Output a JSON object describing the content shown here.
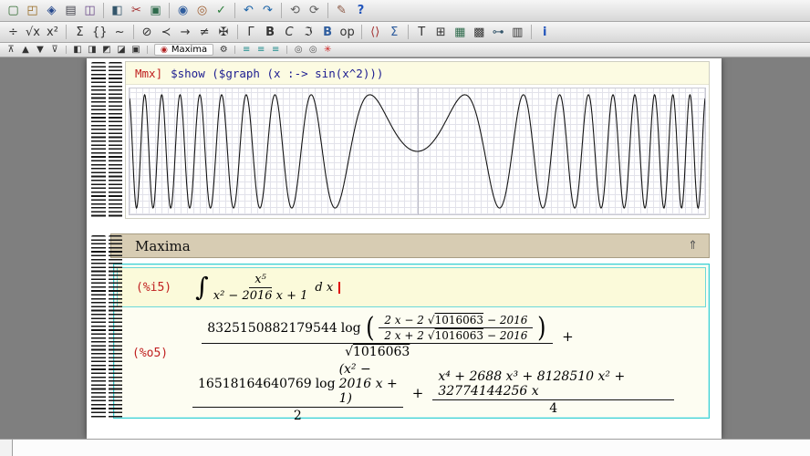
{
  "symbols": {
    "integral": "∫",
    "radical": "√",
    "plus": "+",
    "lparen": "(",
    "rparen": ")"
  },
  "toolbars": {
    "main": {
      "icons": [
        {
          "name": "new-document-icon",
          "glyph": "▢",
          "color": "#2f6b2f"
        },
        {
          "name": "open-document-icon",
          "glyph": "◰",
          "color": "#96691f"
        },
        {
          "name": "save-document-icon",
          "glyph": "◈",
          "color": "#24478c"
        },
        {
          "name": "print-icon",
          "glyph": "▤",
          "color": "#45454f"
        },
        {
          "name": "preview-icon",
          "glyph": "◫",
          "color": "#6b4a8a"
        },
        {
          "sep": true
        },
        {
          "name": "copy-icon",
          "glyph": "◧",
          "color": "#34566b"
        },
        {
          "name": "cut-icon",
          "glyph": "✂",
          "color": "#a33131"
        },
        {
          "name": "paste-icon",
          "glyph": "▣",
          "color": "#2f6b4c"
        },
        {
          "sep": true
        },
        {
          "name": "search-icon",
          "glyph": "◉",
          "color": "#2f5d9e"
        },
        {
          "name": "replace-icon",
          "glyph": "◎",
          "color": "#9e5d2f"
        },
        {
          "name": "spell-check-icon",
          "glyph": "✓",
          "color": "#2a7d3a"
        },
        {
          "sep": true
        },
        {
          "name": "undo-icon",
          "glyph": "↶",
          "color": "#1a63a8"
        },
        {
          "name": "redo-icon",
          "glyph": "↷",
          "color": "#1a63a8"
        },
        {
          "sep": true
        },
        {
          "name": "back-icon",
          "glyph": "⟲",
          "color": "#5f5f5f"
        },
        {
          "name": "forward-icon",
          "glyph": "⟳",
          "color": "#5f5f5f"
        },
        {
          "sep": true
        },
        {
          "name": "compose-icon",
          "glyph": "✎",
          "color": "#8a5540"
        },
        {
          "name": "help-icon",
          "glyph": "?",
          "color": "#2255bb",
          "bold": true
        }
      ]
    },
    "mode": {
      "icons": [
        {
          "name": "fraction-icon",
          "glyph": "÷"
        },
        {
          "name": "sqrt-icon",
          "glyph": "√x"
        },
        {
          "name": "script-icon",
          "glyph": "x²"
        },
        {
          "sep": true
        },
        {
          "name": "sum-icon",
          "glyph": "Σ"
        },
        {
          "name": "braces-icon",
          "glyph": "{}"
        },
        {
          "name": "accent-icon",
          "glyph": "~"
        },
        {
          "sep": true
        },
        {
          "name": "circled-operator-icon",
          "glyph": "⊘"
        },
        {
          "name": "relation-icon",
          "glyph": "≺"
        },
        {
          "name": "arrow-icon",
          "glyph": "→"
        },
        {
          "name": "negation-icon",
          "glyph": "≠"
        },
        {
          "name": "misc-symbol-icon",
          "glyph": "✠"
        },
        {
          "sep": true
        },
        {
          "name": "greek-letter-icon",
          "glyph": "Γ"
        },
        {
          "name": "bold-math-icon",
          "glyph": "B",
          "bold": true
        },
        {
          "name": "calligraphic-icon",
          "glyph": "C",
          "italic": true
        },
        {
          "name": "fraktur-icon",
          "glyph": "ℑ"
        },
        {
          "name": "blackboard-bold-icon",
          "glyph": "B",
          "color": "#2f5d9e",
          "bold": true
        },
        {
          "name": "operator-icon",
          "glyph": "op"
        },
        {
          "sep": true
        },
        {
          "name": "brackets-icon",
          "glyph": "⟨⟩",
          "color": "#a33131"
        },
        {
          "name": "big-operator-icon",
          "glyph": "Σ",
          "color": "#2f5d9e"
        },
        {
          "sep": true
        },
        {
          "name": "text-mode-icon",
          "glyph": "T"
        },
        {
          "name": "insert-table-icon",
          "glyph": "⊞"
        },
        {
          "name": "insert-image-icon",
          "glyph": "▦",
          "color": "#2f6b4c"
        },
        {
          "name": "insert-grid-icon",
          "glyph": "▩"
        },
        {
          "name": "hyperlink-icon",
          "glyph": "⊶",
          "color": "#34566b"
        },
        {
          "name": "clipboard-icon",
          "glyph": "▥"
        },
        {
          "sep": true
        },
        {
          "name": "info-icon",
          "glyph": "i",
          "color": "#2255bb",
          "bold": true
        }
      ]
    },
    "focus": {
      "left_icons": [
        {
          "name": "insert-above-icon",
          "glyph": "⊼"
        },
        {
          "name": "focus-previous-icon",
          "glyph": "▲"
        },
        {
          "name": "focus-next-icon",
          "glyph": "▼"
        },
        {
          "name": "insert-below-icon",
          "glyph": "⊽"
        },
        {
          "sep": true
        },
        {
          "name": "cell-left-icon",
          "glyph": "◧"
        },
        {
          "name": "cell-right-icon",
          "glyph": "◨"
        },
        {
          "name": "cell-top-icon",
          "glyph": "◩"
        },
        {
          "name": "cell-bottom-icon",
          "glyph": "◪"
        },
        {
          "name": "cell-frame-icon",
          "glyph": "▣"
        }
      ],
      "logo_glyph": "◉",
      "logo_color": "#b22222",
      "session_label": "Maxima",
      "wrench_glyph": "⚙",
      "right_icons": [
        {
          "name": "align-left-icon",
          "glyph": "≡",
          "color": "#1a8a8a"
        },
        {
          "name": "align-center-icon",
          "glyph": "≡",
          "color": "#1a8a8a"
        },
        {
          "name": "align-right-icon",
          "glyph": "≡",
          "color": "#1a8a8a"
        },
        {
          "sep": true
        },
        {
          "name": "ring-binder-icon",
          "glyph": "◎",
          "color": "#555555"
        },
        {
          "name": "ring-binder-icon-2",
          "glyph": "◎",
          "color": "#555555"
        },
        {
          "name": "scissors-red-icon",
          "glyph": "✳",
          "color": "#cc2222"
        }
      ]
    }
  },
  "document": {
    "mmx_session": {
      "prompt": "Mmx]",
      "command": "$show ($graph (x :-> sin(x^2)))",
      "plot": {
        "type": "line",
        "expression": "sin(x^2)",
        "x_range": [
          -7.6,
          7.6
        ],
        "y_range": [
          -1,
          1
        ],
        "grid": true
      }
    },
    "maxima_session": {
      "title": "Maxima",
      "collapse_glyph": "⇑",
      "input": {
        "prompt": "(%i5)",
        "numerator": "x⁵",
        "denominator": "x² − 2016 x + 1",
        "differential": "d x"
      },
      "output": {
        "prompt": "(%o5)",
        "term1": {
          "coefficient": "8325150882179544",
          "function": "log",
          "inner_num": {
            "pre": "2 x − 2",
            "sqrt_arg": "1016063",
            "post": "− 2016"
          },
          "inner_den": {
            "pre": "2 x + 2",
            "sqrt_arg": "1016063",
            "post": "− 2016"
          },
          "sqrt_den": "1016063"
        },
        "term2": {
          "coefficient": "16518164640769",
          "function": "log",
          "argument": "(x² − 2016 x + 1)",
          "denominator": "2"
        },
        "term3": {
          "numerator": "x⁴ + 2688 x³ + 8128510 x² + 32774144256 x",
          "denominator": "4"
        }
      }
    }
  }
}
